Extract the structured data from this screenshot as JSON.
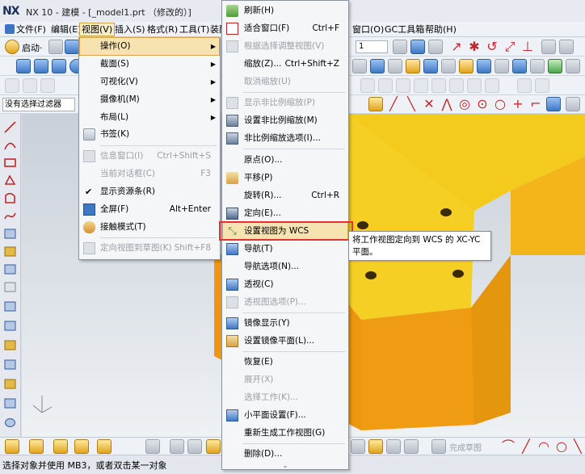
{
  "window": {
    "logo": "NX",
    "title": "NX 10 - 建模 - [_model1.prt （修改的）]"
  },
  "menubar": {
    "items": [
      "文件(F)",
      "编辑(E)",
      "视图(V)",
      "插入(S)",
      "格式(R)",
      "工具(T)",
      "装配",
      "窗口(O)",
      "GC工具箱",
      "帮助(H)"
    ]
  },
  "toolbar": {
    "start_label": "启动·",
    "layer_value": "1"
  },
  "selection": {
    "filter": "没有选择过滤器"
  },
  "view_menu": {
    "items": [
      {
        "label": "操作(O)",
        "shortcut": "",
        "submenu": true,
        "state": "highlighted"
      },
      {
        "label": "截面(S)",
        "shortcut": "",
        "submenu": true
      },
      {
        "label": "可视化(V)",
        "shortcut": "",
        "submenu": true
      },
      {
        "label": "摄像机(M)",
        "shortcut": "",
        "submenu": true
      },
      {
        "label": "布局(L)",
        "shortcut": "",
        "submenu": true
      },
      {
        "label": "书签(K)",
        "shortcut": ""
      },
      {
        "label": "信息窗口(I)",
        "shortcut": "Ctrl+Shift+S",
        "state": "disabled"
      },
      {
        "label": "当前对话框(C)",
        "shortcut": "F3",
        "state": "disabled"
      },
      {
        "label": "显示资源条(R)",
        "shortcut": "",
        "checked": true
      },
      {
        "label": "全屏(F)",
        "shortcut": "Alt+Enter"
      },
      {
        "label": "接触模式(T)",
        "shortcut": ""
      },
      {
        "label": "定向视图到草图(K)",
        "shortcut": "Shift+F8",
        "state": "disabled"
      }
    ]
  },
  "operation_menu": {
    "items": [
      {
        "label": "刷新(H)",
        "shortcut": ""
      },
      {
        "label": "适合窗口(F)",
        "shortcut": "Ctrl+F"
      },
      {
        "label": "根据选择调整视图(V)",
        "shortcut": "",
        "state": "disabled"
      },
      {
        "label": "缩放(Z)...",
        "shortcut": "Ctrl+Shift+Z"
      },
      {
        "label": "取消缩放(U)",
        "shortcut": "",
        "state": "disabled"
      },
      {
        "label": "显示非比例缩放(P)",
        "shortcut": "",
        "state": "disabled"
      },
      {
        "label": "设置非比例缩放(M)",
        "shortcut": ""
      },
      {
        "label": "非比例缩放选项(I)...",
        "shortcut": ""
      },
      {
        "label": "原点(O)...",
        "shortcut": ""
      },
      {
        "label": "平移(P)",
        "shortcut": ""
      },
      {
        "label": "旋转(R)...",
        "shortcut": "Ctrl+R"
      },
      {
        "label": "定向(E)...",
        "shortcut": ""
      },
      {
        "label": "设置视图为 WCS",
        "shortcut": "",
        "state": "highlighted"
      },
      {
        "label": "导航(T)",
        "shortcut": ""
      },
      {
        "label": "导航选项(N)...",
        "shortcut": ""
      },
      {
        "label": "透视(C)",
        "shortcut": ""
      },
      {
        "label": "透视图选项(P)...",
        "shortcut": "",
        "state": "disabled"
      },
      {
        "label": "镜像显示(Y)",
        "shortcut": ""
      },
      {
        "label": "设置镜像平面(L)...",
        "shortcut": ""
      },
      {
        "label": "恢复(E)",
        "shortcut": ""
      },
      {
        "label": "展开(X)",
        "shortcut": "",
        "state": "disabled"
      },
      {
        "label": "选择工作(K)...",
        "shortcut": "",
        "state": "disabled"
      },
      {
        "label": "小平面设置(F)...",
        "shortcut": ""
      },
      {
        "label": "重新生成工作视图(G)",
        "shortcut": ""
      },
      {
        "label": "删除(D)...",
        "shortcut": ""
      }
    ],
    "more": "⌄"
  },
  "tooltip": {
    "text": "将工作视图定向到 WCS 的 XC-YC 平面。"
  },
  "bottom_toolbar": {
    "finish_sketch": "完成草图"
  },
  "status": {
    "text": "选择对象并使用 MB3，或者双击某一对象"
  },
  "colors": {
    "highlight": "#f6e3b0",
    "callout": "#e23131",
    "part_top": "#f5c91f",
    "part_side": "#e99a0e"
  }
}
